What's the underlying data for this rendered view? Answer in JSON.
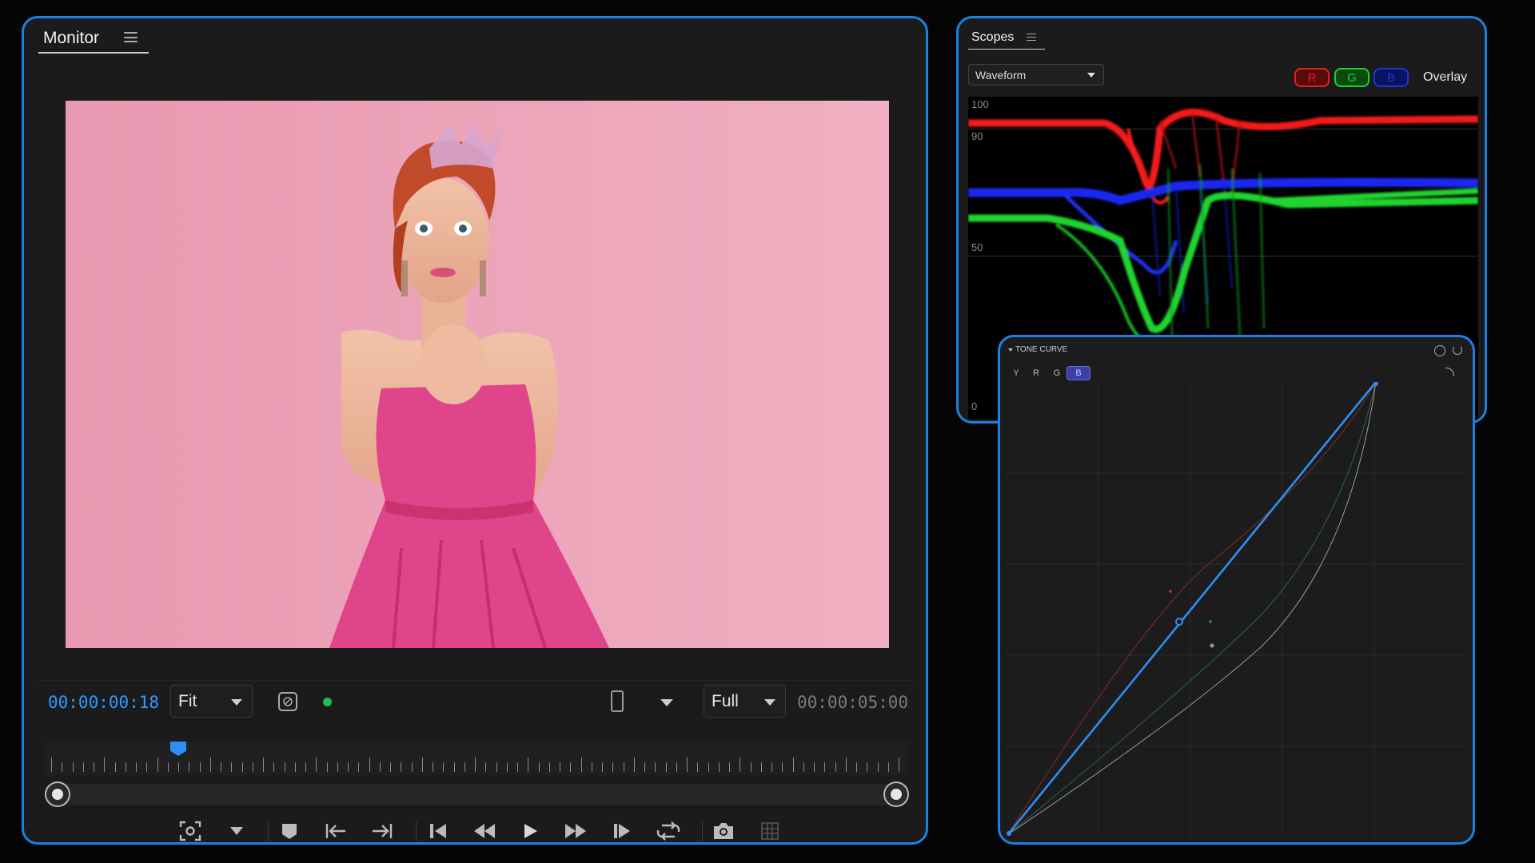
{
  "monitor": {
    "title": "Monitor",
    "current_timecode": "00:00:00:18",
    "zoom_value": "Fit",
    "quality_value": "Full",
    "duration_timecode": "00:00:05:00",
    "playhead_fraction": 0.15,
    "image": {
      "description_icon": "photo-of-woman-in-pink-dress",
      "background_color": "#eea8bd",
      "dress_color": "#e0448a",
      "hair_color": "#c04a2a"
    },
    "status_dot_color": "#1fbf4a",
    "transport_icons": [
      "safe-margins-icon",
      "chevron-down-icon",
      "marker-icon",
      "go-to-in-icon",
      "go-to-out-icon",
      "step-back-icon",
      "rewind-icon",
      "play-icon",
      "fast-forward-icon",
      "step-forward-icon",
      "loop-icon",
      "camera-icon",
      "grid-icon"
    ]
  },
  "scopes": {
    "title": "Scopes",
    "mode_value": "Waveform",
    "channels": [
      {
        "label": "R",
        "color": "#e32020"
      },
      {
        "label": "G",
        "color": "#1fcf2f"
      },
      {
        "label": "B",
        "color": "#2035d8"
      }
    ],
    "overlay_label": "Overlay",
    "scale_labels": [
      "100",
      "90",
      "50",
      "0"
    ]
  },
  "tone_curve": {
    "title": "TONE CURVE",
    "channel_tabs": [
      "Y",
      "R",
      "G",
      "B"
    ],
    "active_tab": "B",
    "accent_color": "#1f7fe0"
  }
}
